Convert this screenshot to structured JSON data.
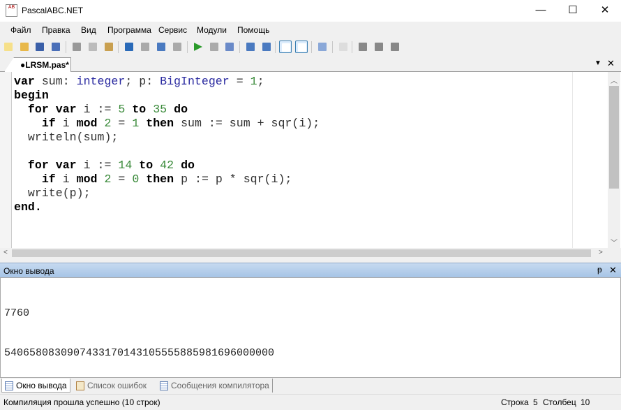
{
  "window": {
    "title": "PascalABC.NET",
    "icon_text": "AB",
    "minimize": "—",
    "maximize": "☐",
    "close": "✕"
  },
  "menu": [
    "Файл",
    "Правка",
    "Вид",
    "Программа",
    "Сервис",
    "Модули",
    "Помощь"
  ],
  "toolbar": [
    "new-file",
    "open",
    "save",
    "save-all",
    "cut",
    "copy",
    "paste",
    "undo",
    "redo",
    "compile",
    "debug",
    "run",
    "stop",
    "build",
    "step-over",
    "step-into",
    "console-toggle",
    "tab-toggle",
    "format",
    "code",
    "insert-d",
    "insert-l",
    "insert-r"
  ],
  "tab": {
    "label": "●LRSM.pas*",
    "dropdown": "▼",
    "close": "✕"
  },
  "code": [
    [
      [
        "var",
        "kw"
      ],
      " sum: ",
      [
        "integer",
        "ty"
      ],
      "; p: ",
      [
        "BigInteger",
        "ty"
      ],
      " = ",
      [
        "1",
        "nu"
      ],
      ";"
    ],
    [
      [
        "begin",
        "kw"
      ]
    ],
    [
      "  ",
      [
        "for",
        "kw"
      ],
      " ",
      [
        "var",
        "kw"
      ],
      " i := ",
      [
        "5",
        "nu"
      ],
      " ",
      [
        "to",
        "kw"
      ],
      " ",
      [
        "35",
        "nu"
      ],
      " ",
      [
        "do",
        "kw"
      ]
    ],
    [
      "    ",
      [
        "if",
        "kw"
      ],
      " i ",
      [
        "mod",
        "kw"
      ],
      " ",
      [
        "2",
        "nu"
      ],
      " = ",
      [
        "1",
        "nu"
      ],
      " ",
      [
        "then",
        "kw"
      ],
      " sum := sum + sqr(i);"
    ],
    [
      "  writeln(sum);"
    ],
    [
      ""
    ],
    [
      "  ",
      [
        "for",
        "kw"
      ],
      " ",
      [
        "var",
        "kw"
      ],
      " i := ",
      [
        "14",
        "nu"
      ],
      " ",
      [
        "to",
        "kw"
      ],
      " ",
      [
        "42",
        "nu"
      ],
      " ",
      [
        "do",
        "kw"
      ]
    ],
    [
      "    ",
      [
        "if",
        "kw"
      ],
      " i ",
      [
        "mod",
        "kw"
      ],
      " ",
      [
        "2",
        "nu"
      ],
      " = ",
      [
        "0",
        "nu"
      ],
      " ",
      [
        "then",
        "kw"
      ],
      " p := p * sqr(i);"
    ],
    [
      "  write(p);"
    ],
    [
      [
        "end.",
        "kw"
      ]
    ]
  ],
  "output_panel": {
    "title": "Окно вывода",
    "pin": "ᵽ",
    "close": "✕",
    "lines": [
      "7760",
      "5406580830907433170143105555885981696000000"
    ]
  },
  "bottom_tabs": [
    "Окно вывода",
    "Список ошибок",
    "Сообщения компилятора"
  ],
  "status": {
    "message": "Компиляция прошла успешно (10 строк)",
    "row_label": "Строка",
    "row": "5",
    "col_label": "Столбец",
    "col": "10"
  }
}
